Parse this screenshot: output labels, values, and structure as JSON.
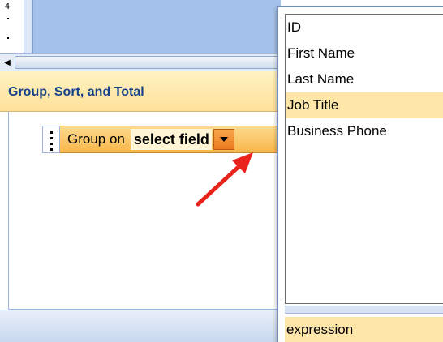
{
  "ruler": {
    "marks": [
      "4"
    ]
  },
  "group_sort_total": {
    "title": "Group, Sort, and Total",
    "group_row": {
      "label": "Group on",
      "field_value": "select field"
    }
  },
  "field_list": {
    "items": [
      "ID",
      "First Name",
      "Last Name",
      "Job Title",
      "Business Phone"
    ],
    "selected_index": 3,
    "expression_label": "expression"
  },
  "icons": {
    "scroll_left": "triangle-left-icon",
    "dropdown": "triangle-down-icon",
    "pointer": "red-arrow-icon",
    "grip": "grip-dots-icon"
  },
  "colors": {
    "header_text": "#15428b",
    "selected_bg": "#fde6a8",
    "dropdown_btn": "#ec7a1e",
    "pointer_arrow": "#e8231c"
  }
}
